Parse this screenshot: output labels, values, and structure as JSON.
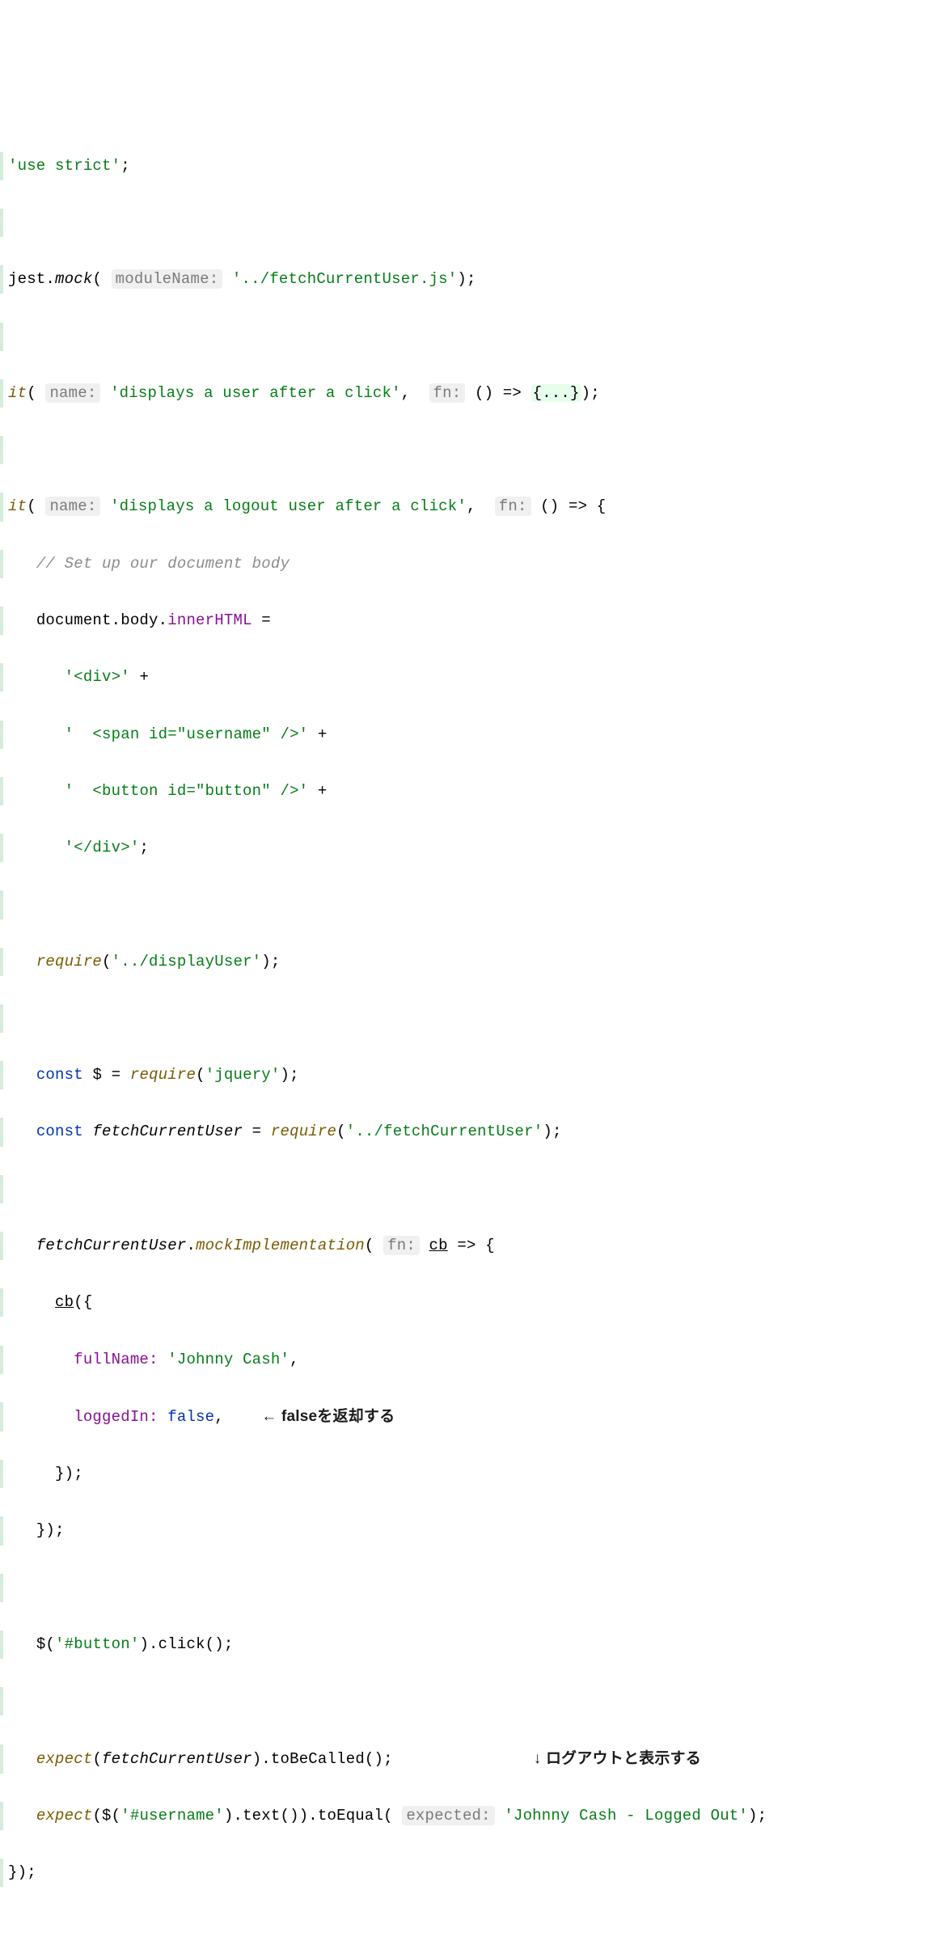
{
  "code": {
    "useStrict": "'use strict'",
    "jestObj": "jest",
    "mock": "mock",
    "moduleNameHint": "moduleName:",
    "fetchUserPath": "'../fetchCurrentUser.js'",
    "it": "it",
    "nameHint": "name:",
    "test1Name": "'displays a user after a click'",
    "fnHint": "fn:",
    "arrowEmpty": "() => ",
    "foldBraces": "{...}",
    "test2Name": "'displays a logout user after a click'",
    "arrowOpen": "() => {",
    "comment1": "// Set up our document body",
    "docBody": "document.body.innerHTML =",
    "html1": "'<div>'",
    "plus": " +",
    "html2": "'  <span id=\"username\" />'",
    "html3": "'  <button id=\"button\" />'",
    "html4": "'</div>'",
    "requireDisplay": "require",
    "displayUserPath": "'../displayUser'",
    "const": "const",
    "dollar": "$ = ",
    "require": "require",
    "jqueryStr": "'jquery'",
    "fetchUserVar": "fetchCurrentUser",
    "fetchUserReqPath": "'../fetchCurrentUser'",
    "mockImpl": "mockImplementation",
    "cb": "cb",
    "cbArrow": " => {",
    "cbCall": "cb",
    "fullName": "fullName: ",
    "johnnyCash": "'Johnny Cash'",
    "loggedIn": "loggedIn: ",
    "false": "false",
    "closeObj": "});",
    "closeFn": "});",
    "btnClick": "$(",
    "buttonStr": "'#button'",
    "clickCall": ").click();",
    "expect": "expect",
    "toBeCalled": ".toBeCalled();",
    "usernameStr": "'#username'",
    "textCall": ").text()).toEqual(",
    "expectedHint": "expected:",
    "expectedStr": "'Johnny Cash - Logged Out'",
    "finalClose": "});"
  },
  "annotations": {
    "falseReturn": "← falseを返却する",
    "logoutDisplay": "↓ ログアウトと表示する"
  }
}
